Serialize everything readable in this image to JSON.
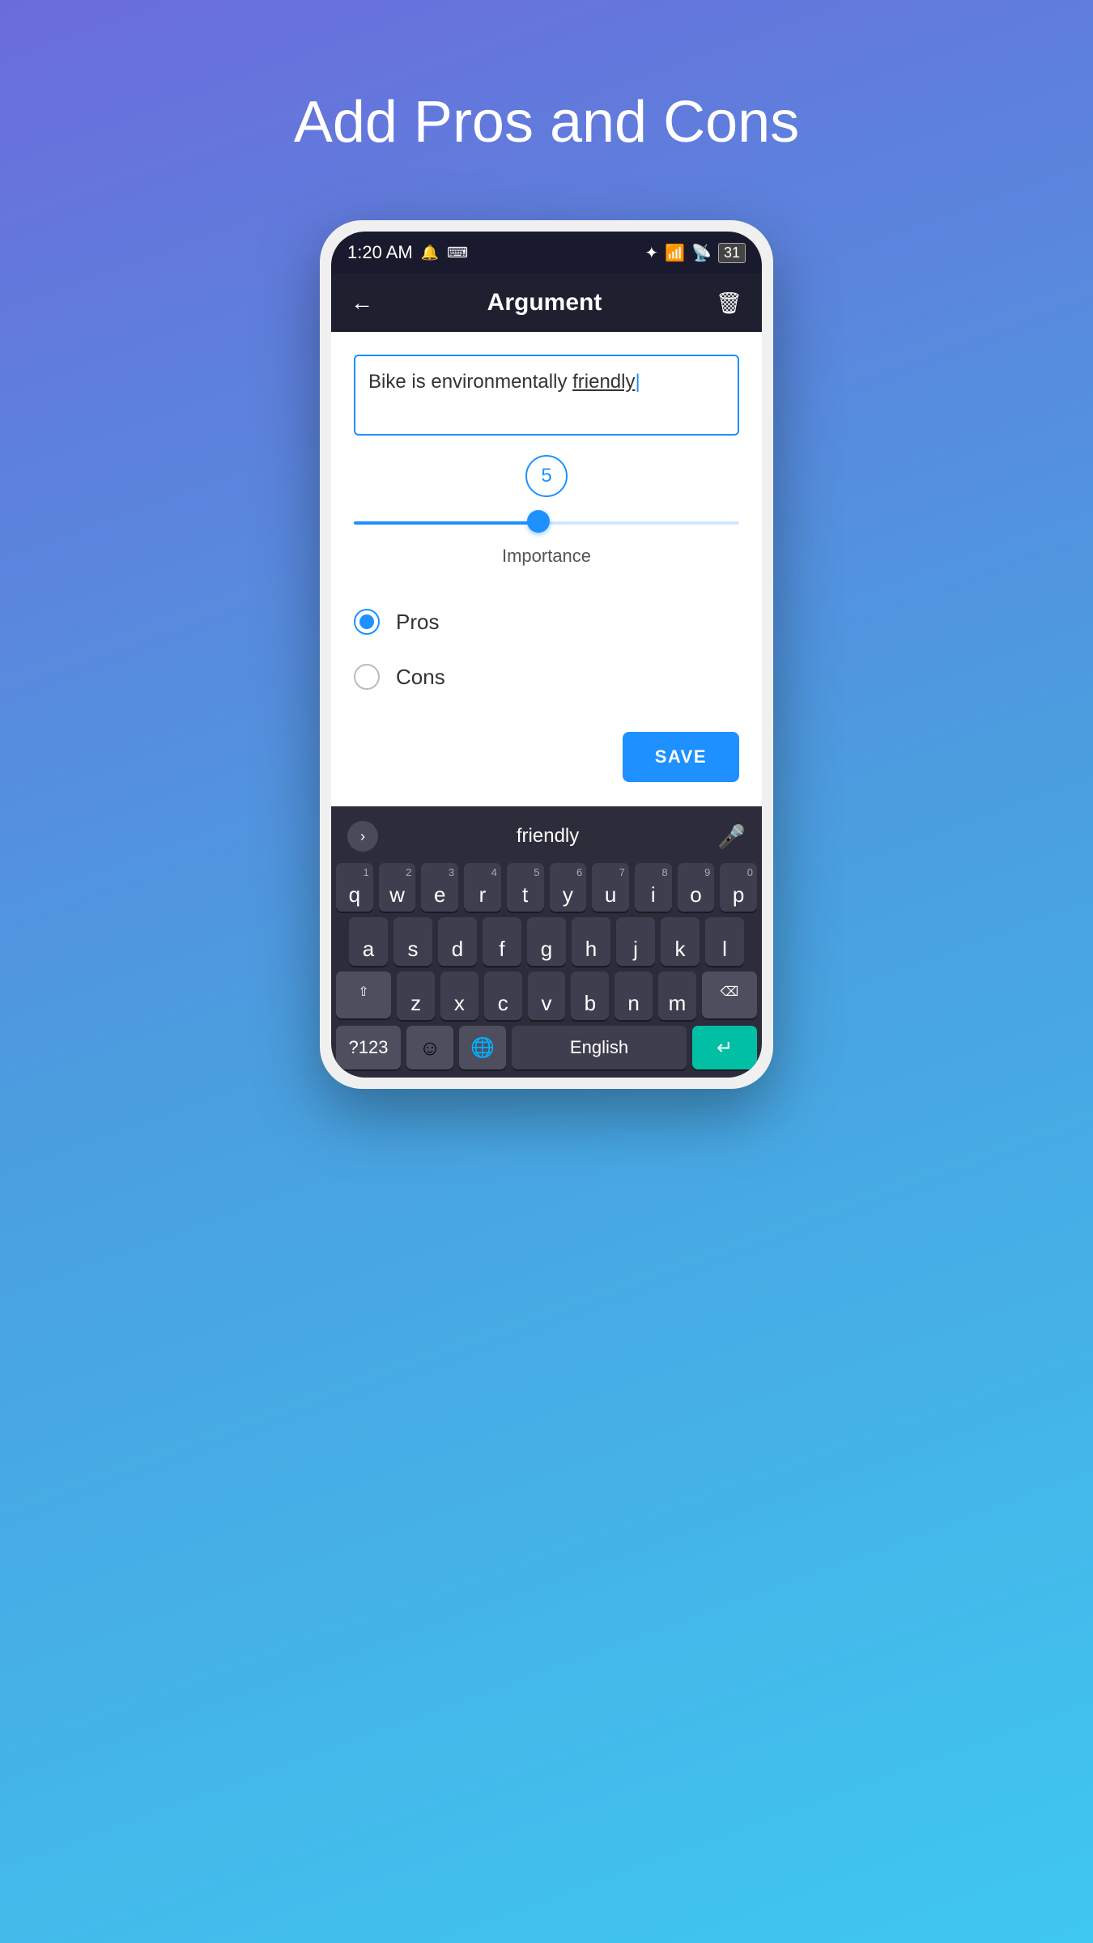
{
  "page": {
    "title": "Add Pros and Cons",
    "background_gradient": [
      "#6b6cdb",
      "#4a9fe0",
      "#3fc8f0"
    ]
  },
  "status_bar": {
    "time": "1:20 AM",
    "bluetooth_icon": "⬡",
    "signal": "▐▐▐",
    "wifi": "wifi",
    "battery": "31"
  },
  "app_bar": {
    "title": "Argument",
    "back_label": "←",
    "delete_label": "🗑"
  },
  "form": {
    "text_input_value": "Bike is environmentally friendly",
    "text_cursor_word": "friendly",
    "slider_value": "5",
    "slider_label": "Importance",
    "pros_label": "Pros",
    "cons_label": "Cons",
    "pros_selected": true,
    "save_button_label": "SAVE"
  },
  "keyboard": {
    "suggestion_word": "friendly",
    "arrow_label": "›",
    "mic_label": "🎤",
    "row1": [
      "q",
      "w",
      "e",
      "r",
      "t",
      "y",
      "u",
      "i",
      "o",
      "p"
    ],
    "row1_nums": [
      "1",
      "2",
      "3",
      "4",
      "5",
      "6",
      "7",
      "8",
      "9",
      "0"
    ],
    "row2": [
      "a",
      "s",
      "d",
      "f",
      "g",
      "h",
      "j",
      "k",
      "l"
    ],
    "row3": [
      "z",
      "x",
      "c",
      "v",
      "b",
      "n",
      "m"
    ],
    "shift_label": "⇧",
    "backspace_label": "⌫",
    "num_label": "?123",
    "emoji_label": "☺",
    "globe_label": "🌐",
    "language_label": "English",
    "enter_label": "↵"
  }
}
